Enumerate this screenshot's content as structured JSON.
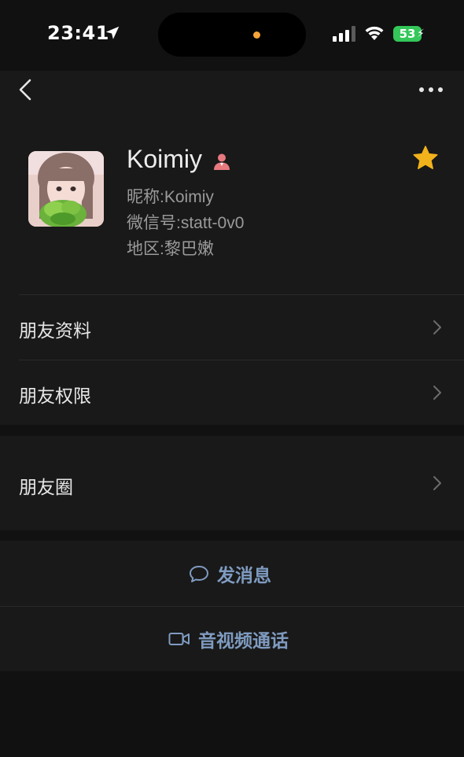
{
  "status_bar": {
    "time": "23:41",
    "battery": "53",
    "battery_color": "#34c759"
  },
  "nav": {
    "back_icon": "chevron-left-icon",
    "more_icon": "ellipsis-icon"
  },
  "profile": {
    "name": "Koimiy",
    "gender_icon": "female-user-icon",
    "starred": true,
    "star_color": "#f2b21b",
    "nickname_label": "昵称:",
    "nickname_value": "Koimiy",
    "wechat_id_label": "微信号:",
    "wechat_id_value": "statt-0v0",
    "region_label": "地区:",
    "region_value": "黎巴嫩"
  },
  "rows": [
    {
      "label": "朋友资料"
    },
    {
      "label": "朋友权限"
    },
    {
      "label": "朋友圈"
    }
  ],
  "actions": {
    "message_label": "发消息",
    "message_icon": "chat-bubble-icon",
    "call_label": "音视频通话",
    "call_icon": "video-camera-icon",
    "accent_color": "#7f9bc0"
  }
}
